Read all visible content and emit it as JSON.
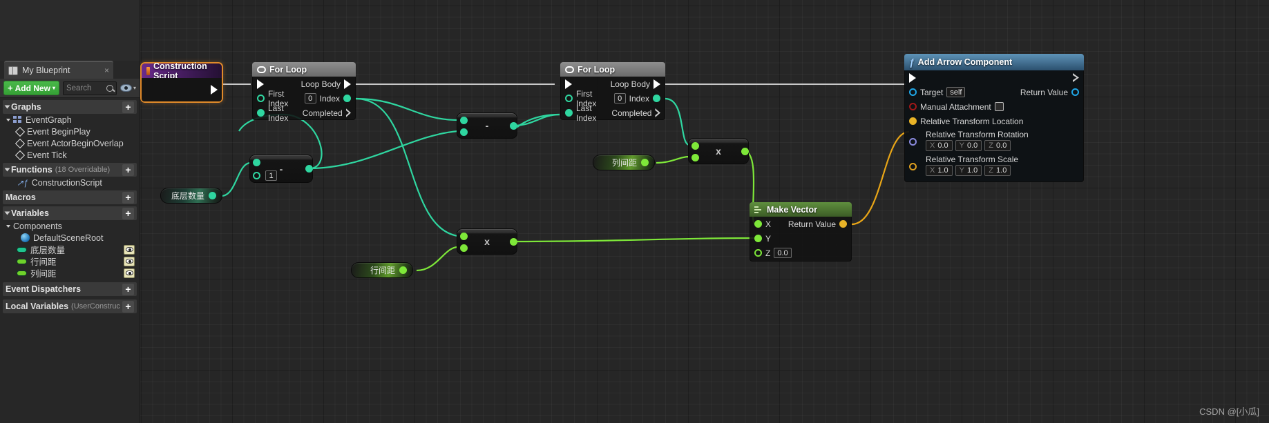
{
  "app": {
    "watermark": "CSDN @[小瓜]"
  },
  "sidebar": {
    "tab": {
      "label": "My Blueprint",
      "close": "×",
      "icon": "book-icon"
    },
    "toolbar": {
      "add_new_label": "Add New",
      "add_new_plus": "+",
      "add_new_caret": "▾",
      "search_placeholder": "Search",
      "eye_caret": "▾"
    },
    "sections": [
      {
        "id": "graphs",
        "label": "Graphs",
        "note": "",
        "plus": "+"
      },
      {
        "id": "functions",
        "label": "Functions",
        "note": "(18 Overridable)",
        "plus": "+"
      },
      {
        "id": "macros",
        "label": "Macros",
        "note": "",
        "plus": "+"
      },
      {
        "id": "variables",
        "label": "Variables",
        "note": "",
        "plus": "+"
      },
      {
        "id": "event_dispatchers",
        "label": "Event Dispatchers",
        "note": "",
        "plus": "+"
      },
      {
        "id": "local_variables",
        "label": "Local Variables",
        "note": "(UserConstruc",
        "plus": "+"
      }
    ],
    "graphs_items": [
      {
        "label": "EventGraph",
        "icon": "graph-icon"
      },
      {
        "label": "Event BeginPlay",
        "icon": "diamond-icon"
      },
      {
        "label": "Event ActorBeginOverlap",
        "icon": "diamond-icon"
      },
      {
        "label": "Event Tick",
        "icon": "diamond-icon"
      }
    ],
    "functions_items": [
      {
        "label": "ConstructionScript",
        "icon": "function-icon"
      }
    ],
    "variables_group": {
      "label": "Components"
    },
    "variables_items": [
      {
        "label": "DefaultSceneRoot",
        "icon": "sphere-icon",
        "color": "#2aa7e0",
        "eye": true
      },
      {
        "label": "底层数量",
        "icon": "variable-pill-icon",
        "color": "#1fc48e",
        "eye": true
      },
      {
        "label": "行间距",
        "icon": "variable-pill-icon",
        "color": "#6fd12a",
        "eye": true
      },
      {
        "label": "列间距",
        "icon": "variable-pill-icon",
        "color": "#6fd12a",
        "eye": true
      }
    ]
  },
  "graph": {
    "nodes": {
      "construction_script": {
        "title": "Construction Script"
      },
      "for_loop_1": {
        "title": "For Loop",
        "first_index_label": "First Index",
        "first_index_value": "0",
        "last_index_label": "Last Index",
        "loop_body_label": "Loop Body",
        "index_label": "Index",
        "completed_label": "Completed"
      },
      "for_loop_2": {
        "title": "For Loop",
        "first_index_label": "First Index",
        "first_index_value": "0",
        "last_index_label": "Last Index",
        "loop_body_label": "Loop Body",
        "index_label": "Index",
        "completed_label": "Completed"
      },
      "subtract_1": {
        "op": "-",
        "value": "1"
      },
      "subtract_2": {
        "op": "-"
      },
      "multiply_1": {
        "op": "x"
      },
      "multiply_2": {
        "op": "x"
      },
      "make_vector": {
        "title": "Make Vector",
        "x_label": "X",
        "y_label": "Y",
        "z_label": "Z",
        "z_value": "0.0",
        "return_label": "Return Value"
      },
      "add_arrow_component": {
        "title": "Add Arrow Component",
        "target_label": "Target",
        "target_value": "self",
        "manual_attachment_label": "Manual Attachment",
        "rel_location_label": "Relative Transform Location",
        "rel_rotation_label": "Relative Transform Rotation",
        "rotation": {
          "x_axis": "X",
          "x": "0.0",
          "y_axis": "Y",
          "y": "0.0",
          "z_axis": "Z",
          "z": "0.0"
        },
        "rel_scale_label": "Relative Transform Scale",
        "scale": {
          "x_axis": "X",
          "x": "1.0",
          "y_axis": "Y",
          "y": "1.0",
          "z_axis": "Z",
          "z": "1.0"
        },
        "return_label": "Return Value"
      },
      "var_dicengshuliang": {
        "label": "底层数量"
      },
      "var_hangjianju": {
        "label": "行间距"
      },
      "var_liejianju": {
        "label": "列间距"
      }
    },
    "colors": {
      "exec_wire": "#c8c8c8",
      "int_wire": "#2fd6a0",
      "float_wire": "#7ee839",
      "vector_wire": "#e8a517"
    }
  }
}
